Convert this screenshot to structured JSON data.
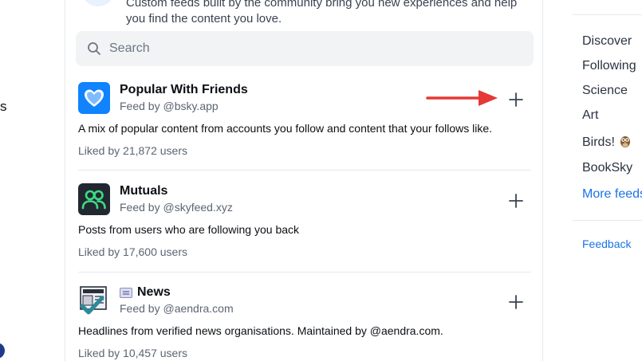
{
  "intro": {
    "line1": "Custom feeds built by the community bring you new experiences and help",
    "line2": "you find the content you love."
  },
  "search": {
    "placeholder": "Search",
    "icon": "search-icon"
  },
  "left_edge": {
    "text": "s"
  },
  "feeds": [
    {
      "name": "Popular With Friends",
      "by": "Feed by @bsky.app",
      "description": "A mix of popular content from accounts you follow and content that your follows like.",
      "liked": "Liked by 21,872 users",
      "icon": "heart-icon",
      "accent": "#1083fe"
    },
    {
      "name": "Mutuals",
      "by": "Feed by @skyfeed.xyz",
      "description": "Posts from users who are following you back",
      "liked": "Liked by 17,600 users",
      "icon": "users-icon",
      "accent": "#222831"
    },
    {
      "name": "News",
      "by": "Feed by @aendra.com",
      "description": "Headlines from verified news organisations. Maintained by @aendra.com.",
      "liked": "Liked by 10,457 users",
      "icon": "newspaper-icon",
      "accent": "#2a8a9a"
    }
  ],
  "sidebar": {
    "links": [
      "Discover",
      "Following",
      "Science",
      "Art",
      "Birds!",
      "BookSky"
    ],
    "more": "More feeds",
    "feedback": "Feedback"
  },
  "colors": {
    "link": "#1a73e8",
    "arrow": "#e53935"
  }
}
